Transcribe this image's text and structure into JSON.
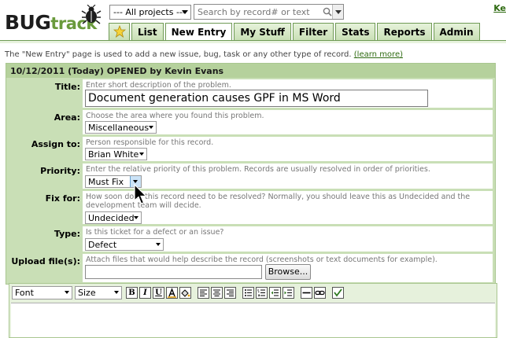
{
  "logo": {
    "part1": "BUG",
    "part2": "track"
  },
  "header": {
    "project_select": "--- All projects ---",
    "search_placeholder": "Search by record# or text",
    "corner_link": "Ke"
  },
  "tabs": [
    {
      "label": "List",
      "underline_index": 0
    },
    {
      "label": "New Entry",
      "active": true
    },
    {
      "label": "My Stuff"
    },
    {
      "label": "Filter"
    },
    {
      "label": "Stats"
    },
    {
      "label": "Reports"
    },
    {
      "label": "Admin"
    }
  ],
  "intro": {
    "text": "The \"New Entry\" page is used to add a new issue, bug, task or any other type of record.",
    "link": "(learn more)"
  },
  "form": {
    "header": "10/12/2011 (Today) OPENED by Kevin Evans",
    "title": {
      "label": "Title:",
      "hint": "Enter short description of the problem.",
      "value": "Document generation causes GPF in MS Word"
    },
    "area": {
      "label": "Area:",
      "hint": "Choose the area where you found this problem.",
      "value": "Miscellaneous"
    },
    "assign": {
      "label": "Assign to:",
      "hint": "Person responsible for this record.",
      "value": "Brian White"
    },
    "priority": {
      "label": "Priority:",
      "hint": "Enter the relative priority of this problem. Records are usually resolved in order of priorities.",
      "value": "Must Fix"
    },
    "fixfor": {
      "label": "Fix for:",
      "hint": "How soon does this record need to be resolved? Normally, you should leave this as Undecided and the",
      "hint2": "development team will decide.",
      "value": "Undecided"
    },
    "type": {
      "label": "Type:",
      "hint": "Is this ticket for a defect or an issue?",
      "value": "Defect"
    },
    "upload": {
      "label": "Upload file(s):",
      "hint": "Attach files that would help describe the record (screenshots or text documents for example).",
      "browse": "Browse..."
    }
  },
  "editor": {
    "font_select": "Font",
    "size_select": "Size",
    "bold": "B",
    "italic": "I",
    "underline": "U"
  }
}
